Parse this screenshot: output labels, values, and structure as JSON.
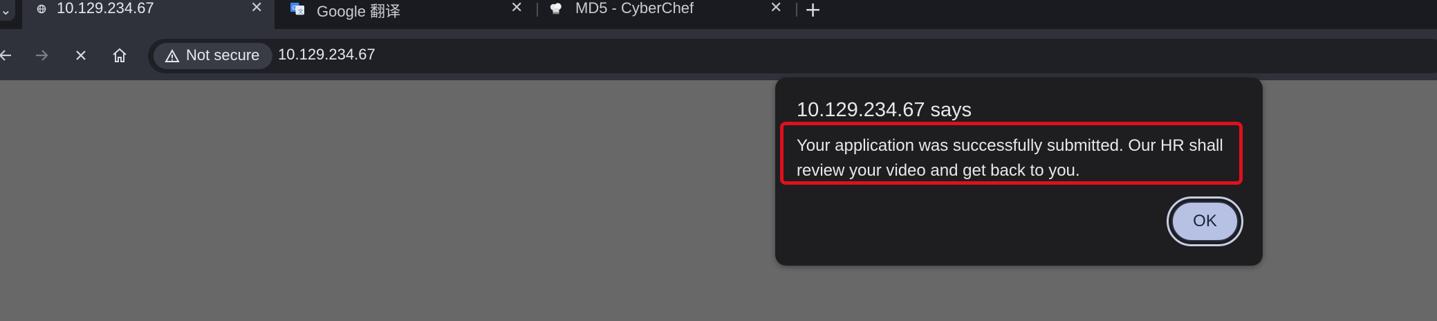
{
  "browser": {
    "tabs": [
      {
        "title": "10.129.234.67",
        "active": true,
        "favicon": "globe-icon"
      },
      {
        "title": "Google 翻译",
        "active": false,
        "favicon": "google-translate-icon"
      },
      {
        "title": "MD5 - CyberChef",
        "active": false,
        "favicon": "chef-hat-icon"
      }
    ],
    "close_glyph": "✕",
    "new_tab_glyph": "+",
    "security_label": "Not secure",
    "url": "10.129.234.67"
  },
  "dialog": {
    "title": "10.129.234.67 says",
    "message": "Your application was successfully submitted. Our HR shall review your video and get back to you.",
    "ok_label": "OK",
    "highlight_color": "#e0101b"
  },
  "colors": {
    "page_overlay": "#686868",
    "toolbar": "#2f323a",
    "tabstrip": "#191b21",
    "dialog_bg": "#1e1e20",
    "ok_button": "#b7c1e4"
  }
}
